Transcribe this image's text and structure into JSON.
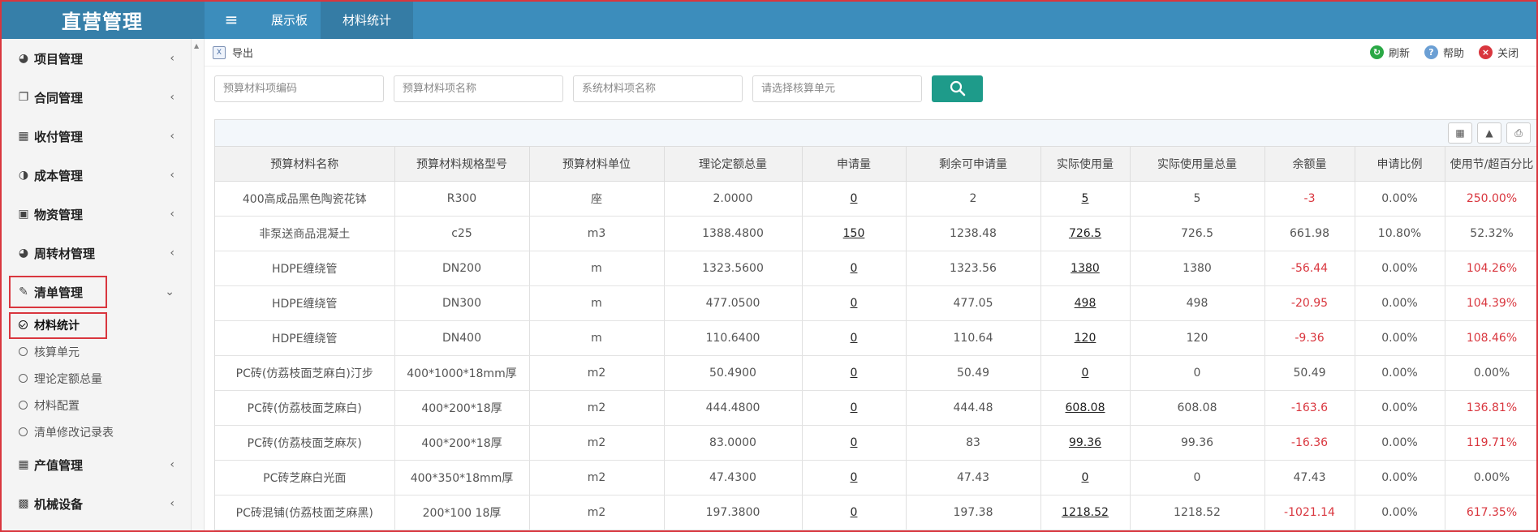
{
  "app": {
    "title": "直营管理"
  },
  "topnav": {
    "tabs": [
      {
        "label": "展示板"
      },
      {
        "label": "材料统计"
      }
    ]
  },
  "sidebar": {
    "items": [
      {
        "label": "项目管理",
        "icon": "dashboard-icon"
      },
      {
        "label": "合同管理",
        "icon": "copy-icon"
      },
      {
        "label": "收付管理",
        "icon": "grid-icon"
      },
      {
        "label": "成本管理",
        "icon": "pie-chart-icon"
      },
      {
        "label": "物资管理",
        "icon": "laptop-icon"
      },
      {
        "label": "周转材管理",
        "icon": "dashboard-icon"
      },
      {
        "label": "清单管理",
        "icon": "edit-icon"
      }
    ],
    "subitems": [
      {
        "label": "材料统计"
      },
      {
        "label": "核算单元"
      },
      {
        "label": "理论定额总量"
      },
      {
        "label": "材料配置"
      },
      {
        "label": "清单修改记录表"
      }
    ],
    "items_after": [
      {
        "label": "产值管理",
        "icon": "table-icon"
      },
      {
        "label": "机械设备",
        "icon": "calendar-icon"
      }
    ]
  },
  "toolbar": {
    "export_label": "导出",
    "refresh_label": "刷新",
    "help_label": "帮助",
    "close_label": "关闭"
  },
  "filters": {
    "code_placeholder": "预算材料项编码",
    "name_placeholder": "预算材料项名称",
    "system_placeholder": "系统材料项名称",
    "unit_placeholder": "请选择核算单元"
  },
  "table": {
    "headers": [
      "预算材料名称",
      "预算材料规格型号",
      "预算材料单位",
      "理论定额总量",
      "申请量",
      "剩余可申请量",
      "实际使用量",
      "实际使用量总量",
      "余额量",
      "申请比例",
      "使用节/超百分比"
    ],
    "rows": [
      [
        "400高成品黑色陶瓷花钵",
        "R300",
        "座",
        "2.0000",
        "0",
        "2",
        "5",
        "5",
        "-3",
        "0.00%",
        "250.00%"
      ],
      [
        "非泵送商品混凝土",
        "c25",
        "m3",
        "1388.4800",
        "150",
        "1238.48",
        "726.5",
        "726.5",
        "661.98",
        "10.80%",
        "52.32%"
      ],
      [
        "HDPE缠绕管",
        "DN200",
        "m",
        "1323.5600",
        "0",
        "1323.56",
        "1380",
        "1380",
        "-56.44",
        "0.00%",
        "104.26%"
      ],
      [
        "HDPE缠绕管",
        "DN300",
        "m",
        "477.0500",
        "0",
        "477.05",
        "498",
        "498",
        "-20.95",
        "0.00%",
        "104.39%"
      ],
      [
        "HDPE缠绕管",
        "DN400",
        "m",
        "110.6400",
        "0",
        "110.64",
        "120",
        "120",
        "-9.36",
        "0.00%",
        "108.46%"
      ],
      [
        "PC砖(仿荔枝面芝麻白)汀步",
        "400*1000*18mm厚",
        "m2",
        "50.4900",
        "0",
        "50.49",
        "0",
        "0",
        "50.49",
        "0.00%",
        "0.00%"
      ],
      [
        "PC砖(仿荔枝面芝麻白)",
        "400*200*18厚",
        "m2",
        "444.4800",
        "0",
        "444.48",
        "608.08",
        "608.08",
        "-163.6",
        "0.00%",
        "136.81%"
      ],
      [
        "PC砖(仿荔枝面芝麻灰)",
        "400*200*18厚",
        "m2",
        "83.0000",
        "0",
        "83",
        "99.36",
        "99.36",
        "-16.36",
        "0.00%",
        "119.71%"
      ],
      [
        "PC砖芝麻白光面",
        "400*350*18mm厚",
        "m2",
        "47.4300",
        "0",
        "47.43",
        "0",
        "0",
        "47.43",
        "0.00%",
        "0.00%"
      ],
      [
        "PC砖混铺(仿荔枝面芝麻黑)",
        "200*100 18厚",
        "m2",
        "197.3800",
        "0",
        "197.38",
        "1218.52",
        "1218.52",
        "-1021.14",
        "0.00%",
        "617.35%"
      ]
    ],
    "negative_rows_cols": "balance<0 and over>100% shown red"
  },
  "colors": {
    "topbar": "#3c8dbc",
    "brand": "#367fa9",
    "search_button": "#1e9b8a",
    "negative": "#d9363e"
  }
}
